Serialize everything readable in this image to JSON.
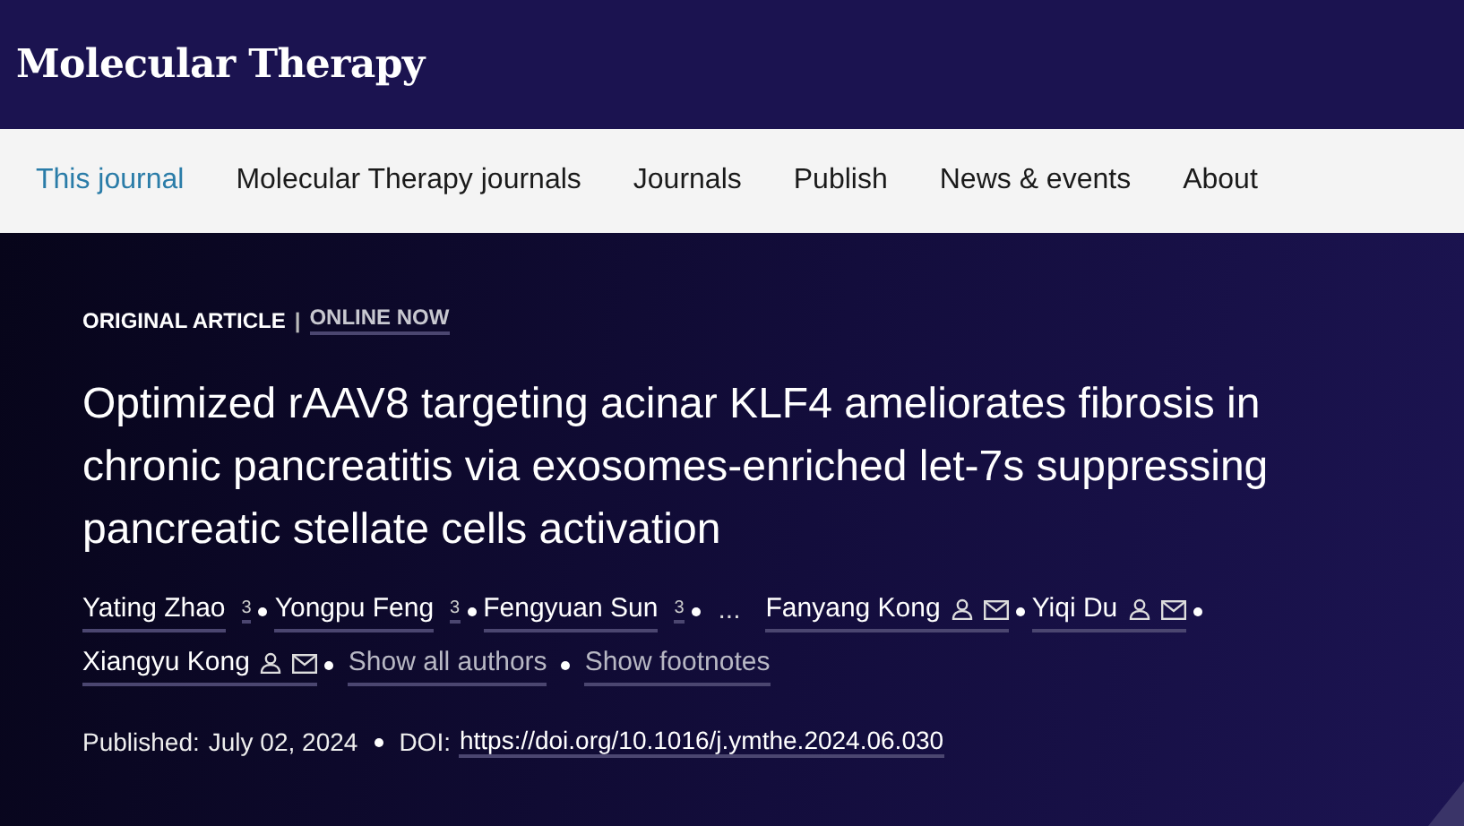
{
  "header": {
    "title": "Molecular Therapy"
  },
  "nav": [
    {
      "label": "This journal",
      "selected": true
    },
    {
      "label": "Molecular Therapy journals",
      "selected": false
    },
    {
      "label": "Journals",
      "selected": false
    },
    {
      "label": "Publish",
      "selected": false
    },
    {
      "label": "News & events",
      "selected": false
    },
    {
      "label": "About",
      "selected": false
    }
  ],
  "article": {
    "type": "ORIGINAL ARTICLE",
    "separator": "|",
    "status": "ONLINE NOW",
    "title": "Optimized rAAV8 targeting acinar KLF4 ameliorates fibrosis in chronic pancreatitis via exosomes-enriched let-7s suppressing pancreatic stellate cells activation",
    "authors": [
      {
        "kind": "author",
        "name": "Yating Zhao",
        "footnote": "3",
        "contact": false
      },
      {
        "kind": "author",
        "name": "Yongpu Feng",
        "footnote": "3",
        "contact": false
      },
      {
        "kind": "author",
        "name": "Fengyuan Sun",
        "footnote": "3",
        "contact": false
      },
      {
        "kind": "ellipsis",
        "name": "..."
      },
      {
        "kind": "author",
        "name": "Fanyang Kong",
        "contact": true
      },
      {
        "kind": "author",
        "name": "Yiqi Du",
        "contact": true
      },
      {
        "kind": "author",
        "name": "Xiangyu Kong",
        "contact": true
      },
      {
        "kind": "link",
        "name": "Show all authors"
      },
      {
        "kind": "link",
        "name": "Show footnotes"
      }
    ],
    "published_label": "Published:",
    "published_date": "July 02, 2024",
    "doi_label": "DOI:",
    "doi": "https://doi.org/10.1016/j.ymthe.2024.06.030"
  }
}
